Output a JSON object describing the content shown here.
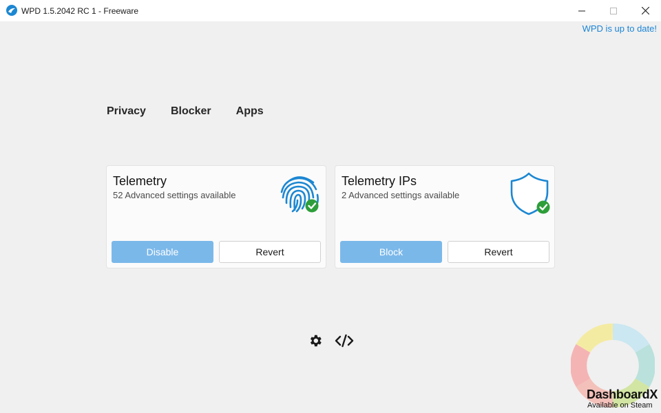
{
  "window": {
    "title": "WPD 1.5.2042 RC 1 - Freeware",
    "minimize_icon": "minimize-icon",
    "maximize_icon": "maximize-icon",
    "close_icon": "close-icon"
  },
  "update_status": "WPD is up to date!",
  "nav": {
    "items": [
      {
        "label": "Privacy"
      },
      {
        "label": "Blocker"
      },
      {
        "label": "Apps"
      }
    ]
  },
  "cards": [
    {
      "title": "Telemetry",
      "subtitle": "52 Advanced settings available",
      "icon": "fingerprint-check-icon",
      "primary_label": "Disable",
      "secondary_label": "Revert"
    },
    {
      "title": "Telemetry IPs",
      "subtitle": "2 Advanced settings available",
      "icon": "shield-check-icon",
      "primary_label": "Block",
      "secondary_label": "Revert"
    }
  ],
  "footer_icons": [
    "settings-gear-icon",
    "code-icon"
  ],
  "watermark": {
    "brand": "DashboardX",
    "tagline": "Available on Steam"
  },
  "colors": {
    "accent": "#1b84d6",
    "primary_button": "#7bb8ea",
    "check_green": "#2e9e3a",
    "icon_blue": "#1c87d2"
  }
}
